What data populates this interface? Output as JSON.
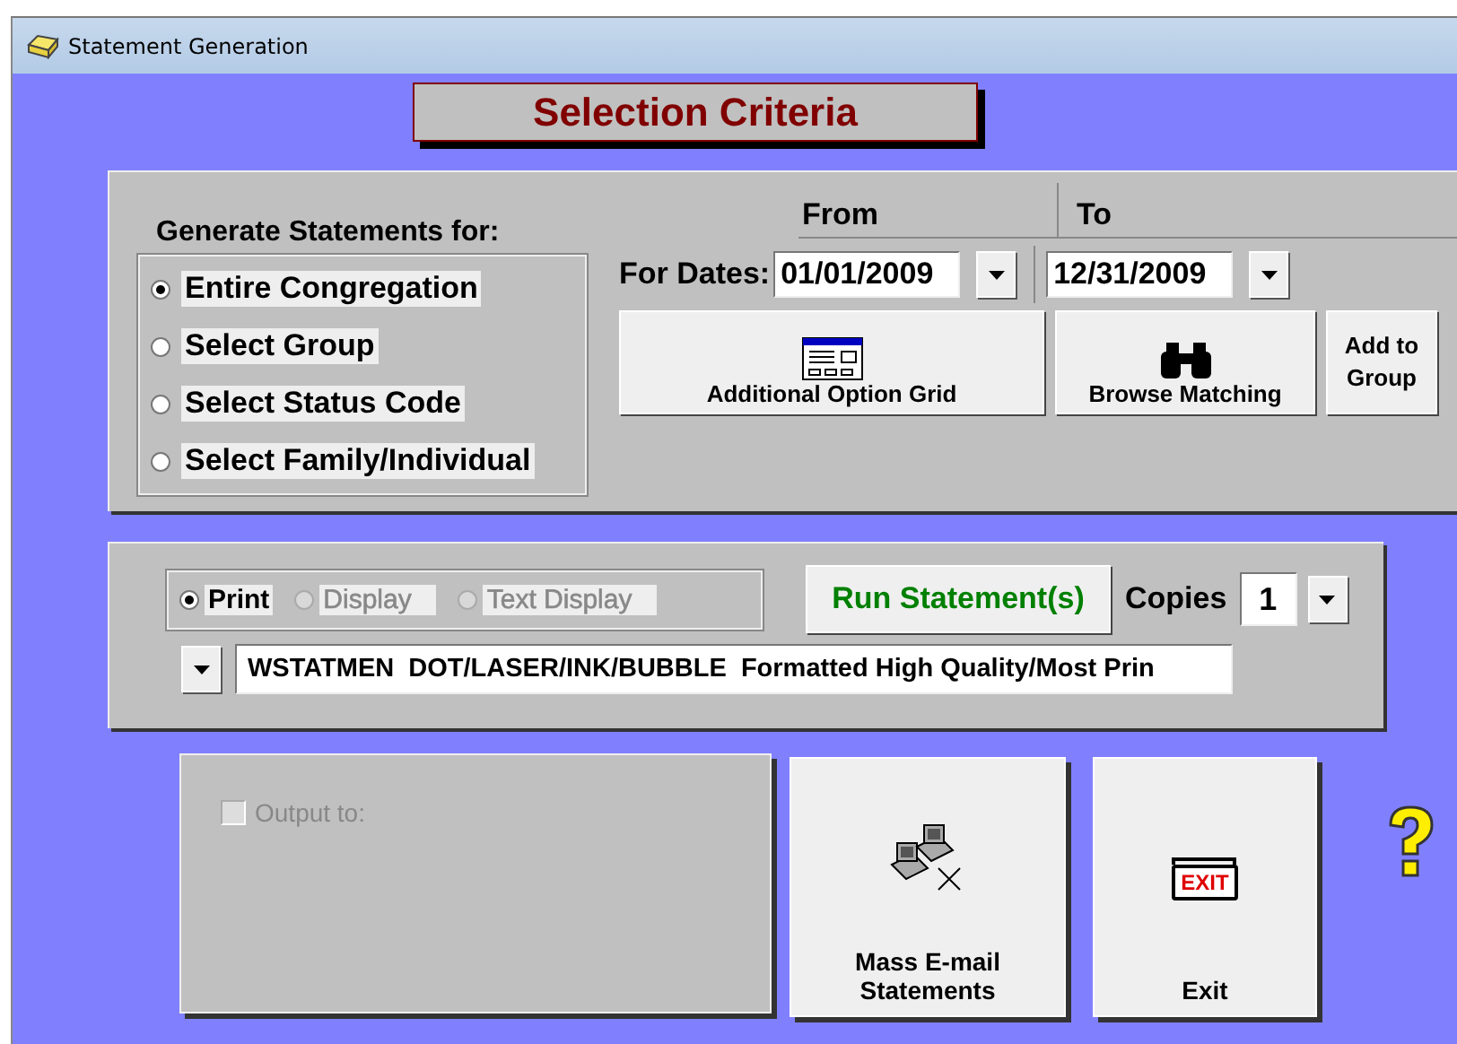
{
  "window": {
    "title": "Statement Generation"
  },
  "heading": "Selection Criteria",
  "generate": {
    "label": "Generate Statements for:",
    "options": [
      {
        "label": "Entire Congregation",
        "selected": true
      },
      {
        "label": "Select Group",
        "selected": false
      },
      {
        "label": "Select Status Code",
        "selected": false
      },
      {
        "label": "Select Family/Individual",
        "selected": false
      }
    ]
  },
  "dates": {
    "from_heading": "From",
    "to_heading": "To",
    "label": "For Dates:",
    "from": "01/01/2009",
    "to": "12/31/2009"
  },
  "buttons": [
    {
      "kind": "grid",
      "label": "Additional Option Grid"
    },
    {
      "kind": "binoculars",
      "label": "Browse Matching"
    },
    {
      "kind": "plain",
      "label": "Add to Group"
    }
  ],
  "output_modes": [
    {
      "label": "Print",
      "selected": true,
      "disabled": false
    },
    {
      "label": "Display",
      "selected": false,
      "disabled": true
    },
    {
      "label": "Text Display",
      "selected": false,
      "disabled": true
    }
  ],
  "run_button": "Run Statement(s)",
  "copies": {
    "label": "Copies",
    "value": "1"
  },
  "format": "WSTATMEN  DOT/LASER/INK/BUBBLE  Formatted High Quality/Most Prin",
  "output_to": {
    "label": "Output to:",
    "checked": false,
    "disabled": true
  },
  "actions": [
    {
      "kind": "email",
      "label": "Mass E-mail Statements"
    },
    {
      "kind": "exit",
      "label": "Exit",
      "sign": "EXIT"
    }
  ]
}
